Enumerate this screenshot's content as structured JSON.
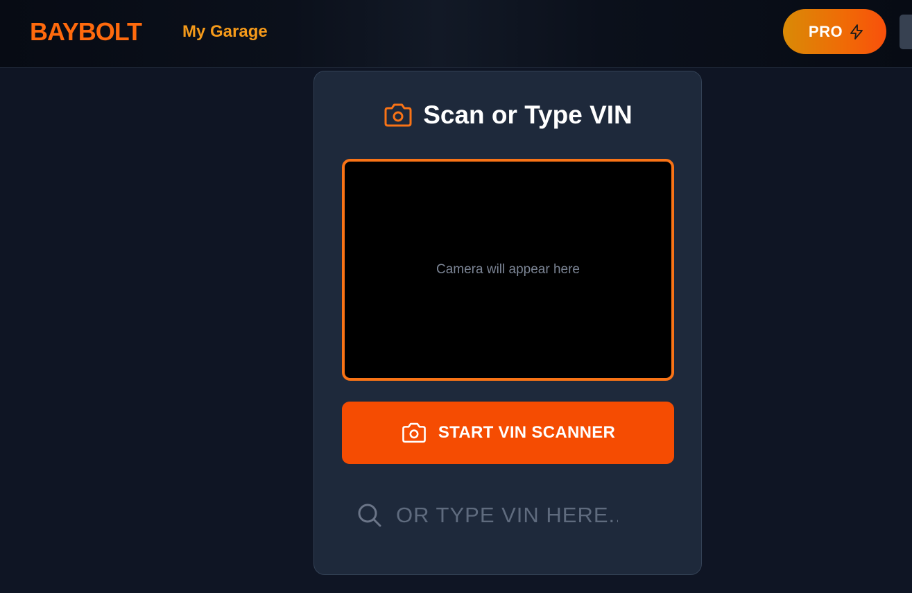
{
  "header": {
    "brand": "BAYBOLT",
    "nav_garage": "My Garage",
    "pro_label": "PRO"
  },
  "scanner": {
    "title": "Scan or Type VIN",
    "camera_placeholder": "Camera will appear here",
    "start_button_label": "START VIN SCANNER",
    "vin_input_value": "",
    "vin_input_placeholder": "OR TYPE VIN HERE..."
  },
  "icons": {
    "title_icon": "camera-icon",
    "button_icon": "camera-icon",
    "search_icon": "search-icon",
    "pro_icon": "lightning-bolt-icon"
  },
  "colors": {
    "accent": "#f97316",
    "brand": "#ff6a0d",
    "button": "#f54c02",
    "background": "#0f1524",
    "card": "#1e293b"
  }
}
